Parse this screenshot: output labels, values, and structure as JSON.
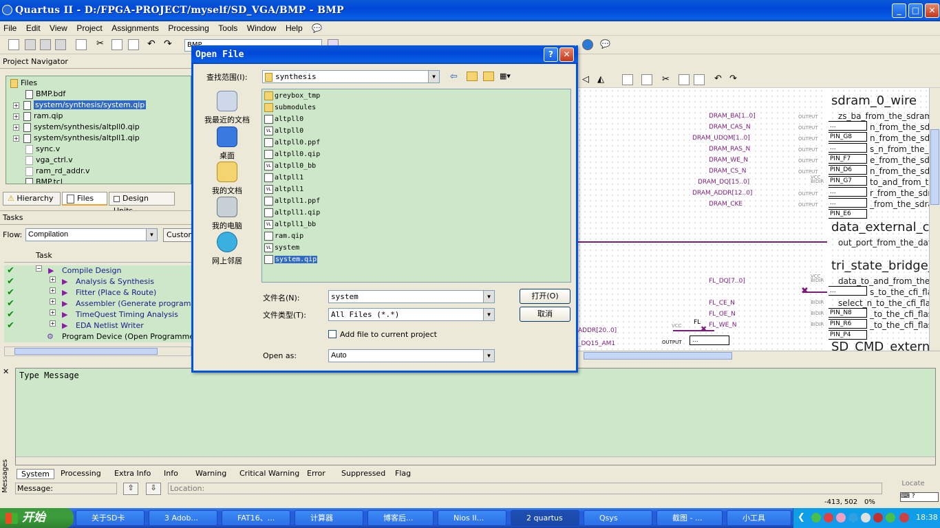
{
  "window": {
    "title": "Quartus II - D:/FPGA-PROJECT/myself/SD_VGA/BMP - BMP"
  },
  "menu": [
    "File",
    "Edit",
    "View",
    "Project",
    "Assignments",
    "Processing",
    "Tools",
    "Window",
    "Help"
  ],
  "toolbar": {
    "entity_combo": "BMP"
  },
  "navigator": {
    "title": "Project Navigator",
    "root": "Files",
    "items": [
      "BMP.bdf",
      "system/synthesis/system.qip",
      "ram.qip",
      "system/synthesis/altpll0.qip",
      "system/synthesis/altpll1.qip",
      "sync.v",
      "vga_ctrl.v",
      "ram_rd_addr.v",
      "BMP.tcl"
    ],
    "tabs": [
      "Hierarchy",
      "Files",
      "Design Units"
    ]
  },
  "tasks": {
    "title": "Tasks",
    "flow_label": "Flow:",
    "flow_value": "Compilation",
    "custom_label": "Customi",
    "col_task": "Task",
    "rows": [
      "Compile Design",
      "Analysis & Synthesis",
      "Fitter (Place & Route)",
      "Assembler (Generate programming",
      "TimeQuest Timing Analysis",
      "EDA Netlist Writer",
      "Program Device (Open Programmer)"
    ]
  },
  "schematic": {
    "signals": [
      "DRAM_BA[1..0]",
      "DRAM_CAS_N",
      "DRAM_UDQM[1..0]",
      "DRAM_RAS_N",
      "DRAM_WE_N",
      "DRAM_CS_N",
      "DRAM_DQ[15..0]",
      "DRAM_ADDR[12..0]",
      "DRAM_CKE",
      "FL_DQ[7..0]",
      "FL_CE_N",
      "FL_OE_N",
      "FL_WE_N",
      "ADDR[20..0]",
      "_DQ15_AM1"
    ],
    "pins": [
      "...",
      "PIN_G8",
      "...",
      "PIN_F7",
      "PIN_D6",
      "PIN_G7",
      "...",
      "...",
      "PIN_E6",
      "...",
      "PIN_N8",
      "PIN_R6",
      "PIN_P4",
      "..."
    ],
    "blocks": [
      "sdram_0_wire",
      "data_external_co",
      "tri_state_bridge_",
      "SD_CMD_extern"
    ],
    "ports": [
      "zs_ba_from_the_sdram",
      "n_from_the_sd",
      "n_from_the_sdra",
      "s_n_from_the_sd",
      "e_from_the_sdr",
      "n_from_the_sdr",
      "to_and_from_the",
      "r_from_the_sdra",
      "_from_the_sdra",
      "out_port_from_the_data",
      "data_to_and_from_the_",
      "s_to_the_cfi_flas",
      "select_n_to_the_cfi_fla",
      "_to_the_cfi_flasl",
      "_to_the_cfi_flas"
    ],
    "misc": {
      "output": "OUTPUT",
      "bidir": "BIDIR",
      "vcc": "VCC",
      "fl": "FL"
    }
  },
  "dialog": {
    "title": "Open File",
    "look_in_label": "查找范围(I):",
    "look_in_value": "synthesis",
    "places": [
      "我最近的文档",
      "桌面",
      "我的文档",
      "我的电脑",
      "网上邻居"
    ],
    "files": [
      {
        "name": "greybox_tmp",
        "type": "folder"
      },
      {
        "name": "submodules",
        "type": "folder"
      },
      {
        "name": "altpll0",
        "type": "file"
      },
      {
        "name": "altpll0",
        "type": "vl"
      },
      {
        "name": "altpll0.ppf",
        "type": "file"
      },
      {
        "name": "altpll0.qip",
        "type": "file"
      },
      {
        "name": "altpll0_bb",
        "type": "vl"
      },
      {
        "name": "altpll1",
        "type": "file"
      },
      {
        "name": "altpll1",
        "type": "vl"
      },
      {
        "name": "altpll1.ppf",
        "type": "file"
      },
      {
        "name": "altpll1.qip",
        "type": "file"
      },
      {
        "name": "altpll1_bb",
        "type": "vl"
      },
      {
        "name": "ram.qip",
        "type": "file"
      },
      {
        "name": "system",
        "type": "vl"
      },
      {
        "name": "system.qip",
        "type": "file",
        "selected": true
      }
    ],
    "filename_label": "文件名(N):",
    "filename_value": "system",
    "filetype_label": "文件类型(T):",
    "filetype_value": "All Files (*.*)",
    "open_button": "打开(O)",
    "cancel_button": "取消",
    "add_file_label": "Add file to current project",
    "open_as_label": "Open as:",
    "open_as_value": "Auto"
  },
  "messages": {
    "col_type": "Type",
    "col_message": "Message",
    "tabs": [
      "System",
      "Processing",
      "Extra Info",
      "Info",
      "Warning",
      "Critical Warning",
      "Error",
      "Suppressed",
      "Flag"
    ],
    "side_label": "Messages",
    "message_label": "Message:",
    "location_placeholder": "Location:",
    "locate_button": "Locate"
  },
  "status": {
    "coords": "-413, 502",
    "zoom": "0%"
  },
  "taskbar": {
    "start": "开始",
    "tasks": [
      "关于SD卡",
      "3 Adob...",
      "FAT16、...",
      "计算器",
      "博客后...",
      "Nios II...",
      "2 quartus",
      "Qsys",
      "截图 - ...",
      "小工具"
    ],
    "clock": "18:38"
  }
}
